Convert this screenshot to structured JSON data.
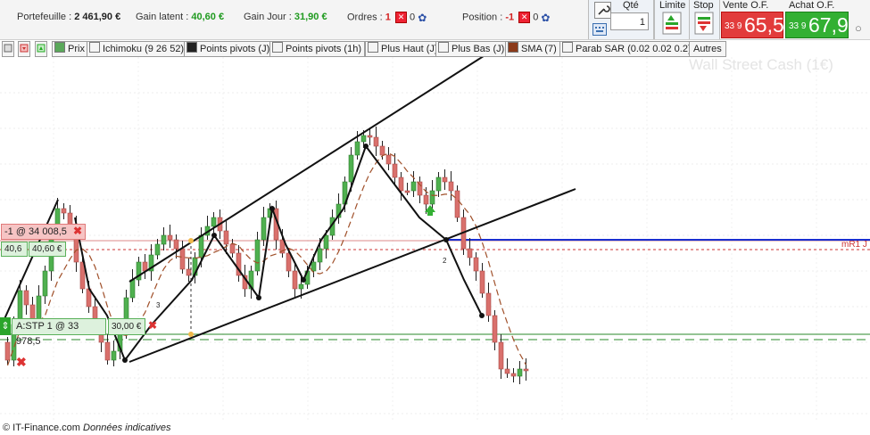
{
  "header": {
    "portfolio": {
      "label": "Portefeuille :",
      "value": "2 461,90 €"
    },
    "unrealized": {
      "label": "Gain latent :",
      "value": "40,60 €"
    },
    "day_gain": {
      "label": "Gain Jour :",
      "value": "31,90 €"
    },
    "orders": {
      "label": "Ordres :",
      "count": "1",
      "zero": "0"
    },
    "position": {
      "label": "Position :",
      "count": "-1",
      "zero": "0"
    }
  },
  "trade": {
    "qty_label": "Qté",
    "qty_value": "1",
    "limit_label": "Limite",
    "stop_label": "Stop",
    "sell_label": "Vente O.F.",
    "sell_prefix": "33 9",
    "sell_price": "65,5",
    "buy_label": "Achat O.F.",
    "buy_prefix": "33 9",
    "buy_price": "67,9",
    "close_symbol": "○"
  },
  "indicators": [
    {
      "label": "Prix",
      "swatch": "#5aa85a"
    },
    {
      "label": "Ichimoku (9 26 52)",
      "swatch": "#e8e8e8"
    },
    {
      "label": "Points pivots (J)",
      "swatch": "#222222"
    },
    {
      "label": "Points pivots (1h)",
      "swatch": "#e8e8e8"
    },
    {
      "label": "Plus Haut (J)",
      "swatch": "#e8e8e8"
    },
    {
      "label": "Plus Bas (J)",
      "swatch": "#e8e8e8"
    },
    {
      "label": "SMA (7)",
      "swatch": "#8b3a1a"
    },
    {
      "label": "Parab SAR (0.02 0.02 0.2)",
      "swatch": "#e8e8e8"
    }
  ],
  "others_label": "Autres",
  "watermark": "Wall Street Cash (1€)",
  "chart": {
    "position_tag": {
      "label": "-1 @ 34 008,5",
      "pnl_left": "40,6",
      "pnl_right": "40,60 €"
    },
    "stop_tag": {
      "label": "A:STP 1 @ 33 978,5",
      "value": "30,00 €"
    },
    "pivot_label": "mR1 J",
    "wave_labels": [
      "3",
      "2"
    ]
  },
  "footer": {
    "copyright": "© IT-Finance.com",
    "note": "Données indicatives"
  },
  "colors": {
    "up": "#4fb04f",
    "down": "#d9706c",
    "accent_blue": "#1a2fd1",
    "sell": "#e23c3c",
    "buy": "#33b033"
  }
}
